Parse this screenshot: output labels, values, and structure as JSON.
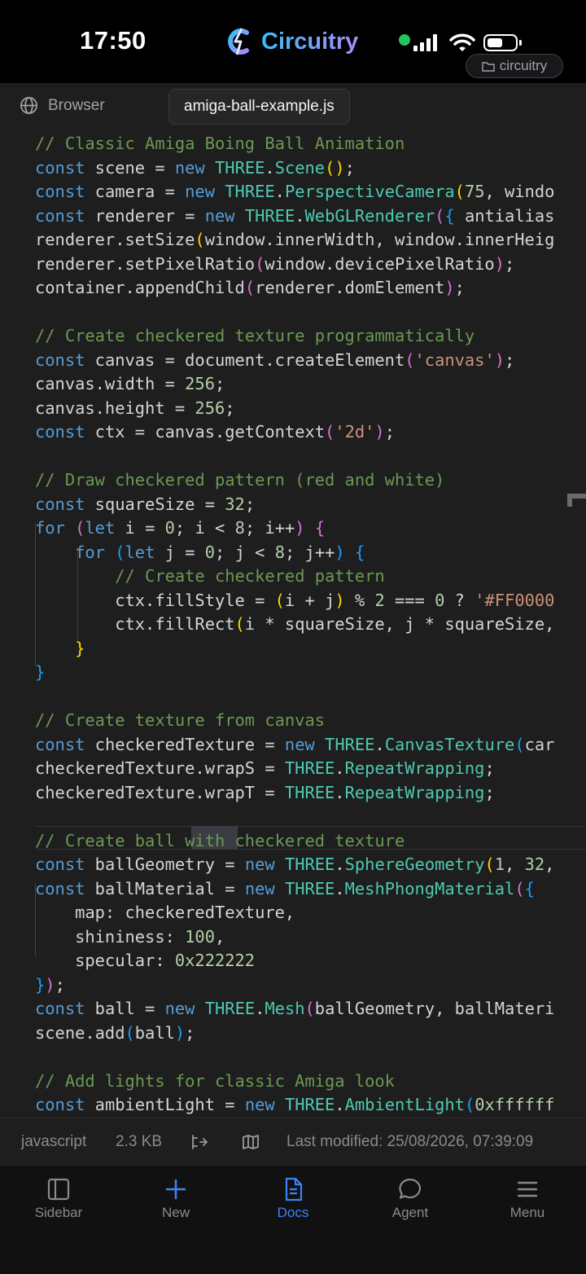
{
  "status_bar": {
    "time": "17:50",
    "app_name": "Circuitry",
    "folder_chip": "circuitry",
    "connection_dot_color": "#22c55e"
  },
  "tabs": {
    "browser_label": "Browser",
    "file_label": "amiga-ball-example.js"
  },
  "code": {
    "lines": [
      "// Classic Amiga Boing Ball Animation",
      "const scene = new THREE.Scene();",
      "const camera = new THREE.PerspectiveCamera(75, windo",
      "const renderer = new THREE.WebGLRenderer({ antialias",
      "renderer.setSize(window.innerWidth, window.innerHeig",
      "renderer.setPixelRatio(window.devicePixelRatio);",
      "container.appendChild(renderer.domElement);",
      "",
      "// Create checkered texture programmatically",
      "const canvas = document.createElement('canvas');",
      "canvas.width = 256;",
      "canvas.height = 256;",
      "const ctx = canvas.getContext('2d');",
      "",
      "// Draw checkered pattern (red and white)",
      "const squareSize = 32;",
      "for (let i = 0; i < 8; i++) {",
      "    for (let j = 0; j < 8; j++) {",
      "        // Create checkered pattern",
      "        ctx.fillStyle = (i + j) % 2 === 0 ? '#FF0000",
      "        ctx.fillRect(i * squareSize, j * squareSize,",
      "    }",
      "}",
      "",
      "// Create texture from canvas",
      "const checkeredTexture = new THREE.CanvasTexture(car",
      "checkeredTexture.wrapS = THREE.RepeatWrapping;",
      "checkeredTexture.wrapT = THREE.RepeatWrapping;",
      "",
      "// Create ball with checkered texture",
      "const ballGeometry = new THREE.SphereGeometry(1, 32,",
      "const ballMaterial = new THREE.MeshPhongMaterial({",
      "    map: checkeredTexture,",
      "    shininess: 100,",
      "    specular: 0x222222",
      "});",
      "const ball = new THREE.Mesh(ballGeometry, ballMateri",
      "scene.add(ball);",
      "",
      "// Add lights for classic Amiga look",
      "const ambientLight = new THREE.AmbientLight(0xffffff"
    ]
  },
  "info_bar": {
    "language": "javascript",
    "size": "2.3 KB",
    "last_modified": "Last modified: 25/08/2026, 07:39:09"
  },
  "nav": {
    "sidebar": "Sidebar",
    "new": "New",
    "docs": "Docs",
    "agent": "Agent",
    "menu": "Menu"
  },
  "colors": {
    "accent": "#3b82f6",
    "background": "#1e1e1e",
    "keyword": "#569cd6",
    "comment": "#6a9955",
    "class": "#4ec9b0",
    "number": "#b5cea8",
    "string": "#ce9178"
  }
}
